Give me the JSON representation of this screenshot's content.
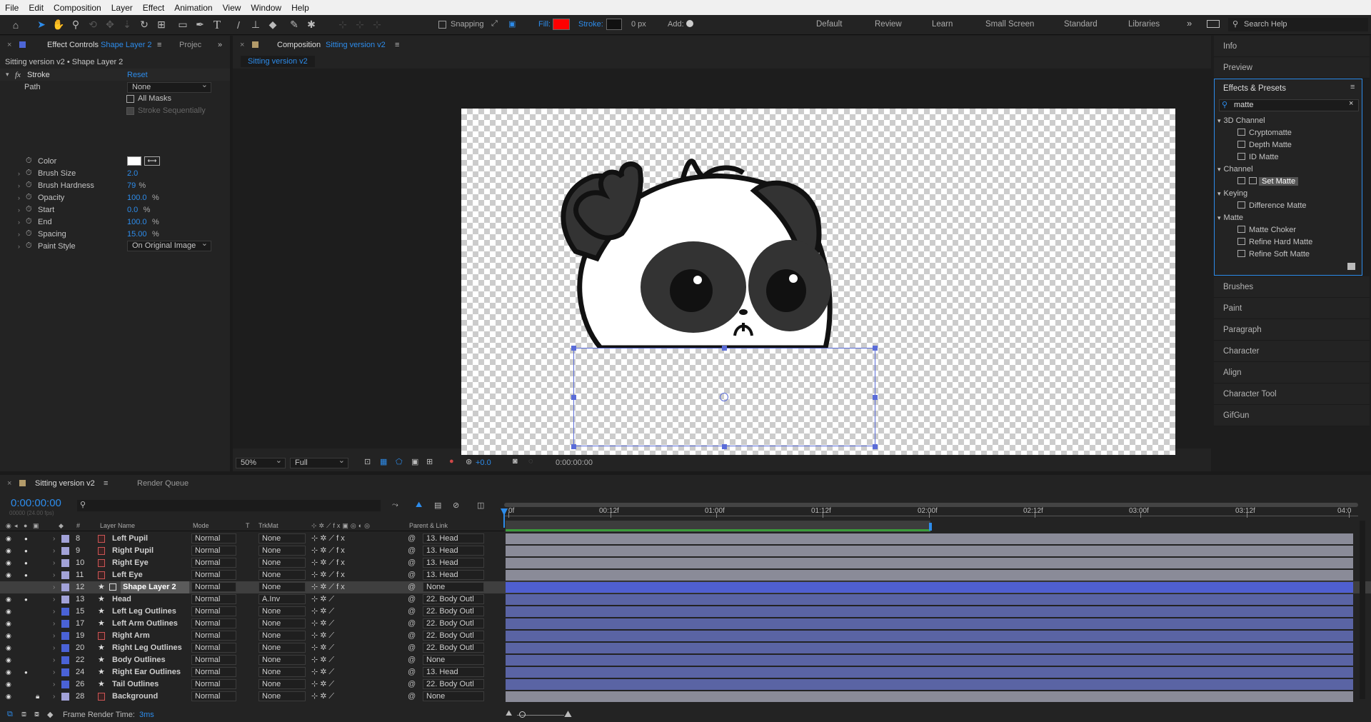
{
  "menu": [
    "File",
    "Edit",
    "Composition",
    "Layer",
    "Effect",
    "Animation",
    "View",
    "Window",
    "Help"
  ],
  "toolbar": {
    "snapping": "Snapping",
    "fill_label": "Fill:",
    "stroke_label": "Stroke:",
    "stroke_px": "0 px",
    "add_label": "Add:",
    "fill_color": "#ff0000",
    "workspaces": [
      "Default",
      "Review",
      "Learn",
      "Small Screen",
      "Standard",
      "Libraries"
    ],
    "search_help": "Search Help"
  },
  "effect_controls": {
    "tab_label": "Effect Controls",
    "tab_layer": "Shape Layer 2",
    "project_tab": "Projec",
    "header": "Sitting version v2 • Shape Layer 2",
    "effect_name": "Stroke",
    "reset": "Reset",
    "path_label": "Path",
    "path_value": "None",
    "all_masks": "All Masks",
    "stroke_seq": "Stroke Sequentially",
    "props": [
      {
        "label": "Color",
        "value": ""
      },
      {
        "label": "Brush Size",
        "value": "2.0"
      },
      {
        "label": "Brush Hardness",
        "value": "79",
        "unit": "%"
      },
      {
        "label": "Opacity",
        "value": "100.0",
        "unit": "%"
      },
      {
        "label": "Start",
        "value": "0.0",
        "unit": "%"
      },
      {
        "label": "End",
        "value": "100.0",
        "unit": "%"
      },
      {
        "label": "Spacing",
        "value": "15.00",
        "unit": "%"
      },
      {
        "label": "Paint Style",
        "value": "On Original Image"
      }
    ]
  },
  "composition": {
    "tab_prefix": "Composition",
    "tab_name": "Sitting version v2",
    "subtab": "Sitting version v2",
    "zoom": "50%",
    "resolution": "Full",
    "exposure": "+0.0",
    "timecode": "0:00:00:00"
  },
  "right_panels": {
    "top": [
      "Info",
      "Preview"
    ],
    "effects_title": "Effects & Presets",
    "search_value": "matte",
    "tree": [
      {
        "kind": "cat",
        "label": "3D Channel"
      },
      {
        "kind": "item",
        "label": "Cryptomatte"
      },
      {
        "kind": "item",
        "label": "Depth Matte"
      },
      {
        "kind": "item",
        "label": "ID Matte"
      },
      {
        "kind": "cat",
        "label": "Channel"
      },
      {
        "kind": "item",
        "label": "Set Matte",
        "selected": true
      },
      {
        "kind": "cat",
        "label": "Keying"
      },
      {
        "kind": "item",
        "label": "Difference Matte"
      },
      {
        "kind": "cat",
        "label": "Matte"
      },
      {
        "kind": "item",
        "label": "Matte Choker"
      },
      {
        "kind": "item",
        "label": "Refine Hard Matte"
      },
      {
        "kind": "item",
        "label": "Refine Soft Matte"
      }
    ],
    "bottom": [
      "Brushes",
      "Paint",
      "Paragraph",
      "Character",
      "Align",
      "Character Tool",
      "GifGun"
    ]
  },
  "timeline": {
    "tab_name": "Sitting version v2",
    "render_queue": "Render Queue",
    "timecode": "0:00:00:00",
    "fps": "00000 (24.00 fps)",
    "headers": {
      "num": "#",
      "layer_name": "Layer Name",
      "mode": "Mode",
      "t": "T",
      "trkmat": "TrkMat",
      "parent": "Parent & Link"
    },
    "ruler": [
      "0f",
      "00:12f",
      "01:00f",
      "01:12f",
      "02:00f",
      "02:12f",
      "03:00f",
      "03:12f",
      "04:0"
    ],
    "layers": [
      {
        "num": "8",
        "name": "Left Pupil",
        "mode": "Normal",
        "trkmat": "None",
        "parent": "13. Head",
        "color": "#a2a2d8",
        "type": "shape",
        "eye": true,
        "solo": true,
        "fx": true,
        "bar": "#8a8b98"
      },
      {
        "num": "9",
        "name": "Right Pupil",
        "mode": "Normal",
        "trkmat": "None",
        "parent": "13. Head",
        "color": "#a2a2d8",
        "type": "shape",
        "eye": true,
        "solo": true,
        "fx": true,
        "bar": "#8a8b98"
      },
      {
        "num": "10",
        "name": "Right Eye",
        "mode": "Normal",
        "trkmat": "None",
        "parent": "13. Head",
        "color": "#a2a2d8",
        "type": "shape",
        "eye": true,
        "solo": true,
        "fx": true,
        "bar": "#8a8b98"
      },
      {
        "num": "11",
        "name": "Left Eye",
        "mode": "Normal",
        "trkmat": "None",
        "parent": "13. Head",
        "color": "#a2a2d8",
        "type": "shape",
        "eye": true,
        "solo": true,
        "fx": true,
        "bar": "#8a8b98"
      },
      {
        "num": "12",
        "name": "Shape Layer 2",
        "mode": "Normal",
        "trkmat": "None",
        "parent": "None",
        "color": "#a2a2d8",
        "type": "star",
        "eye": false,
        "solo": false,
        "fx": true,
        "selected": true,
        "bar": "#4f5fd0"
      },
      {
        "num": "13",
        "name": "Head",
        "mode": "Normal",
        "trkmat": "A.Inv",
        "parent": "22. Body Outl",
        "color": "#a2a2d8",
        "type": "star",
        "eye": true,
        "solo": true,
        "fx": false,
        "bar": "#5a64a4"
      },
      {
        "num": "15",
        "name": "Left Leg Outlines",
        "mode": "Normal",
        "trkmat": "None",
        "parent": "22. Body Outl",
        "color": "#4a62d6",
        "type": "star",
        "eye": true,
        "solo": false,
        "fx": false,
        "bar": "#5a64a4"
      },
      {
        "num": "17",
        "name": "Left Arm Outlines",
        "mode": "Normal",
        "trkmat": "None",
        "parent": "22. Body Outl",
        "color": "#4a62d6",
        "type": "star",
        "eye": true,
        "solo": false,
        "fx": false,
        "bar": "#5a64a4"
      },
      {
        "num": "19",
        "name": "Right Arm",
        "mode": "Normal",
        "trkmat": "None",
        "parent": "22. Body Outl",
        "color": "#4a62d6",
        "type": "shape",
        "eye": true,
        "solo": false,
        "fx": false,
        "bar": "#5a64a4"
      },
      {
        "num": "20",
        "name": "Right Leg Outlines",
        "mode": "Normal",
        "trkmat": "None",
        "parent": "22. Body Outl",
        "color": "#4a62d6",
        "type": "star",
        "eye": true,
        "solo": false,
        "fx": false,
        "bar": "#5a64a4"
      },
      {
        "num": "22",
        "name": "Body Outlines",
        "mode": "Normal",
        "trkmat": "None",
        "parent": "None",
        "color": "#4a62d6",
        "type": "star",
        "eye": true,
        "solo": false,
        "fx": false,
        "bar": "#5a64a4"
      },
      {
        "num": "24",
        "name": "Right Ear Outlines",
        "mode": "Normal",
        "trkmat": "None",
        "parent": "13. Head",
        "color": "#4a62d6",
        "type": "star",
        "eye": true,
        "solo": true,
        "fx": false,
        "bar": "#5a64a4"
      },
      {
        "num": "26",
        "name": "Tail Outlines",
        "mode": "Normal",
        "trkmat": "None",
        "parent": "22. Body Outl",
        "color": "#4a62d6",
        "type": "star",
        "eye": true,
        "solo": false,
        "fx": false,
        "bar": "#5a64a4"
      },
      {
        "num": "28",
        "name": "Background",
        "mode": "Normal",
        "trkmat": "None",
        "parent": "None",
        "color": "#a2a2d8",
        "type": "shape",
        "eye": true,
        "solo": false,
        "lock": true,
        "fx": false,
        "bar": "#8a8b98"
      }
    ],
    "render_time_label": "Frame Render Time:",
    "render_time_value": "3ms"
  }
}
